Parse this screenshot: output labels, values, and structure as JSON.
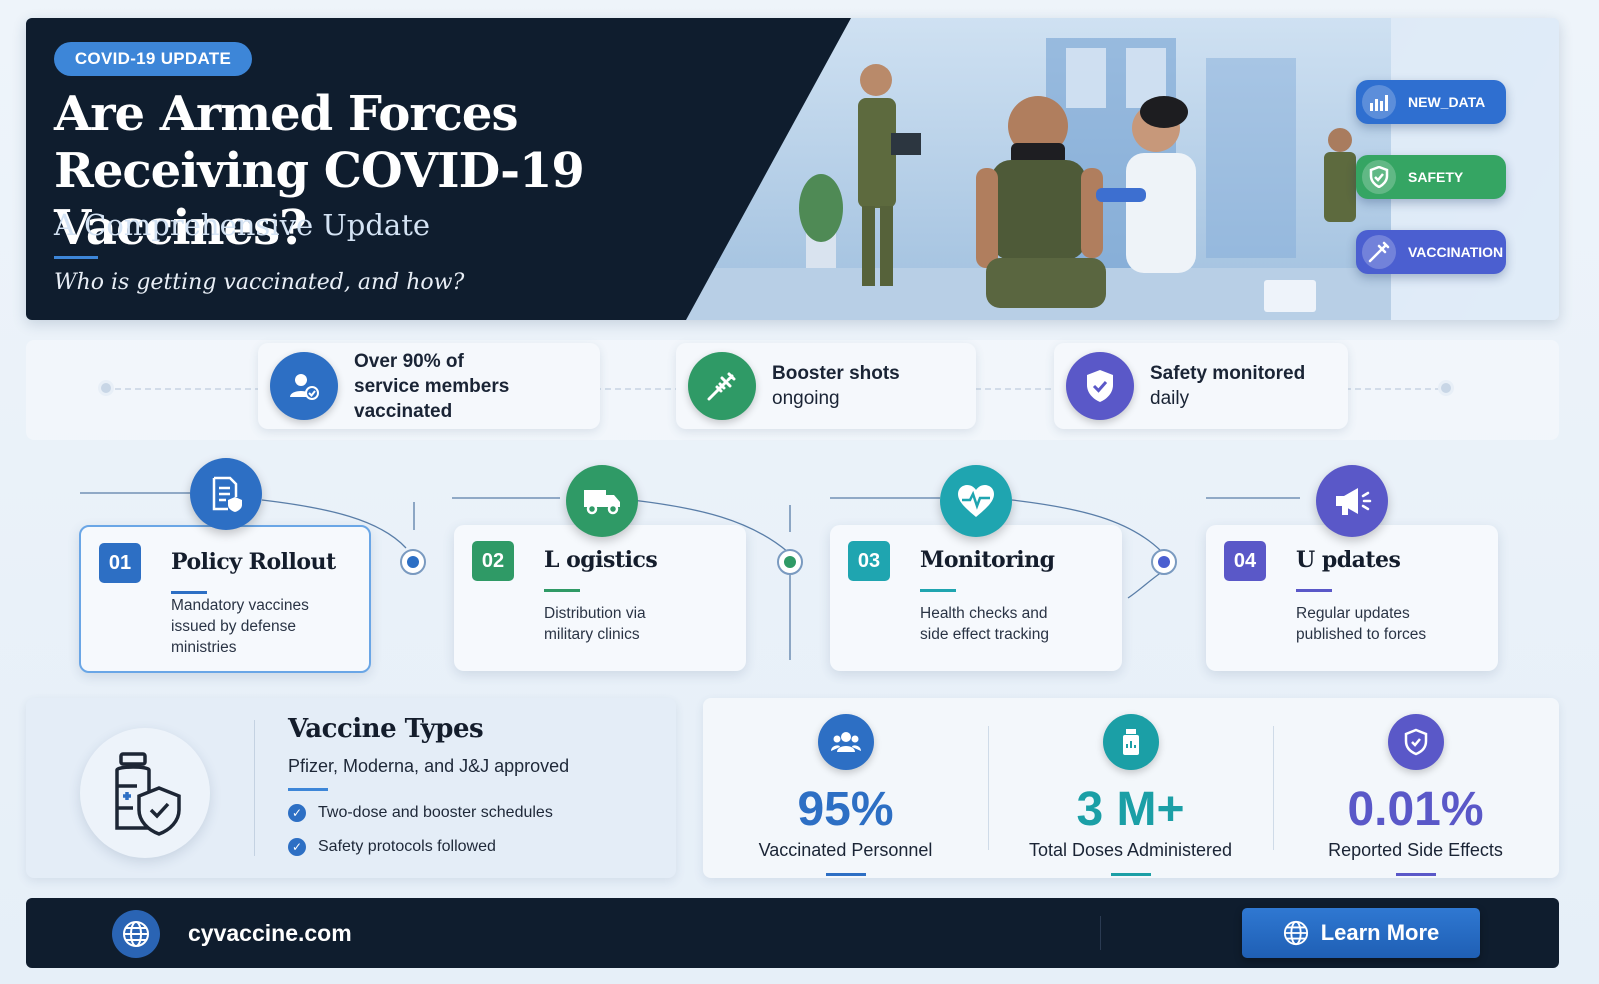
{
  "hero": {
    "badge": "COVID-19 UPDATE",
    "title_line1": "Are Armed Forces",
    "title_line2": "Receiving COVID-19 Vaccines?",
    "subtitle": "A Comprehensive Update",
    "question": "Who is getting vaccinated, and how?",
    "tags": [
      {
        "label": "NEW_DATA",
        "icon": "bar-chart-icon",
        "color": "#2f6fd0"
      },
      {
        "label": "SAFETY",
        "icon": "shield-icon",
        "color": "#35a563"
      },
      {
        "label": "VACCINATION",
        "icon": "syringe-icon",
        "color": "#4b5fd0"
      }
    ]
  },
  "highlights": [
    {
      "line1": "Over 90% of",
      "line2": "service members vaccinated",
      "icon": "user-check-icon",
      "color": "#2d6fc4"
    },
    {
      "line1": "Booster shots",
      "line2": "ongoing",
      "icon": "syringe-icon",
      "color": "#2f9a66"
    },
    {
      "line1": "Safety monitored",
      "line2": "daily",
      "icon": "shield-check-icon",
      "color": "#5a58c8"
    }
  ],
  "steps": [
    {
      "num": "01",
      "title": "Policy Rollout",
      "desc": "Mandatory vaccines issued by defense ministries",
      "icon": "document-shield-icon",
      "color": "#2d6fc4"
    },
    {
      "num": "02",
      "title": "L ogistics",
      "desc": "Distribution via military clinics",
      "icon": "truck-icon",
      "color": "#2f9a66"
    },
    {
      "num": "03",
      "title": "Monitoring",
      "desc": "Health checks and side effect tracking",
      "icon": "heart-pulse-icon",
      "color": "#1fa5b0"
    },
    {
      "num": "04",
      "title": "U pdates",
      "desc": "Regular updates published to forces",
      "icon": "megaphone-icon",
      "color": "#5a58c8"
    }
  ],
  "vaccine_types": {
    "title": "Vaccine Types",
    "subtitle": "Pfizer, Moderna, and J&J approved",
    "checks": [
      "Two-dose and booster schedules",
      "Safety protocols followed"
    ]
  },
  "metrics": [
    {
      "value": "95%",
      "label": "Vaccinated Personnel",
      "icon": "people-icon",
      "color": "#2d6fc4"
    },
    {
      "value": "3 M+",
      "label": "Total Doses Administered",
      "icon": "vial-icon",
      "color": "#1b9fa6"
    },
    {
      "value": "0.01%",
      "label": "Reported Side Effects",
      "icon": "shield-icon",
      "color": "#5a58c8"
    }
  ],
  "footer": {
    "site": "cyvaccine.com",
    "button": "Learn More"
  }
}
